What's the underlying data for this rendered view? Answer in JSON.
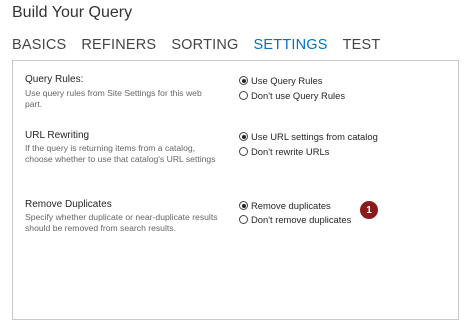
{
  "page": {
    "title": "Build Your Query"
  },
  "tabs": [
    {
      "label": "BASICS",
      "active": false
    },
    {
      "label": "REFINERS",
      "active": false
    },
    {
      "label": "SORTING",
      "active": false
    },
    {
      "label": "SETTINGS",
      "active": true
    },
    {
      "label": "TEST",
      "active": false
    }
  ],
  "colors": {
    "active_tab": "#0072c6",
    "callout_badge": "#8b1a1a",
    "panel_border": "#c6c6c6"
  },
  "settings": {
    "query_rules": {
      "label": "Query Rules:",
      "description": "Use query rules from Site Settings for this web part.",
      "options": [
        {
          "label": "Use Query Rules",
          "checked": true
        },
        {
          "label": "Don't use Query Rules",
          "checked": false
        }
      ]
    },
    "url_rewriting": {
      "label": "URL Rewriting",
      "description": "If the query is returning items from a catalog, choose whether to use that catalog's URL settings",
      "options": [
        {
          "label": "Use URL settings from catalog",
          "checked": true
        },
        {
          "label": "Don't rewrite URLs",
          "checked": false
        }
      ]
    },
    "remove_duplicates": {
      "label": "Remove Duplicates",
      "description": "Specify whether duplicate or near-duplicate results should be removed from search results.",
      "options": [
        {
          "label": "Remove duplicates",
          "checked": true
        },
        {
          "label": "Don't remove duplicates",
          "checked": false
        }
      ]
    }
  },
  "callout": {
    "number": "1"
  }
}
